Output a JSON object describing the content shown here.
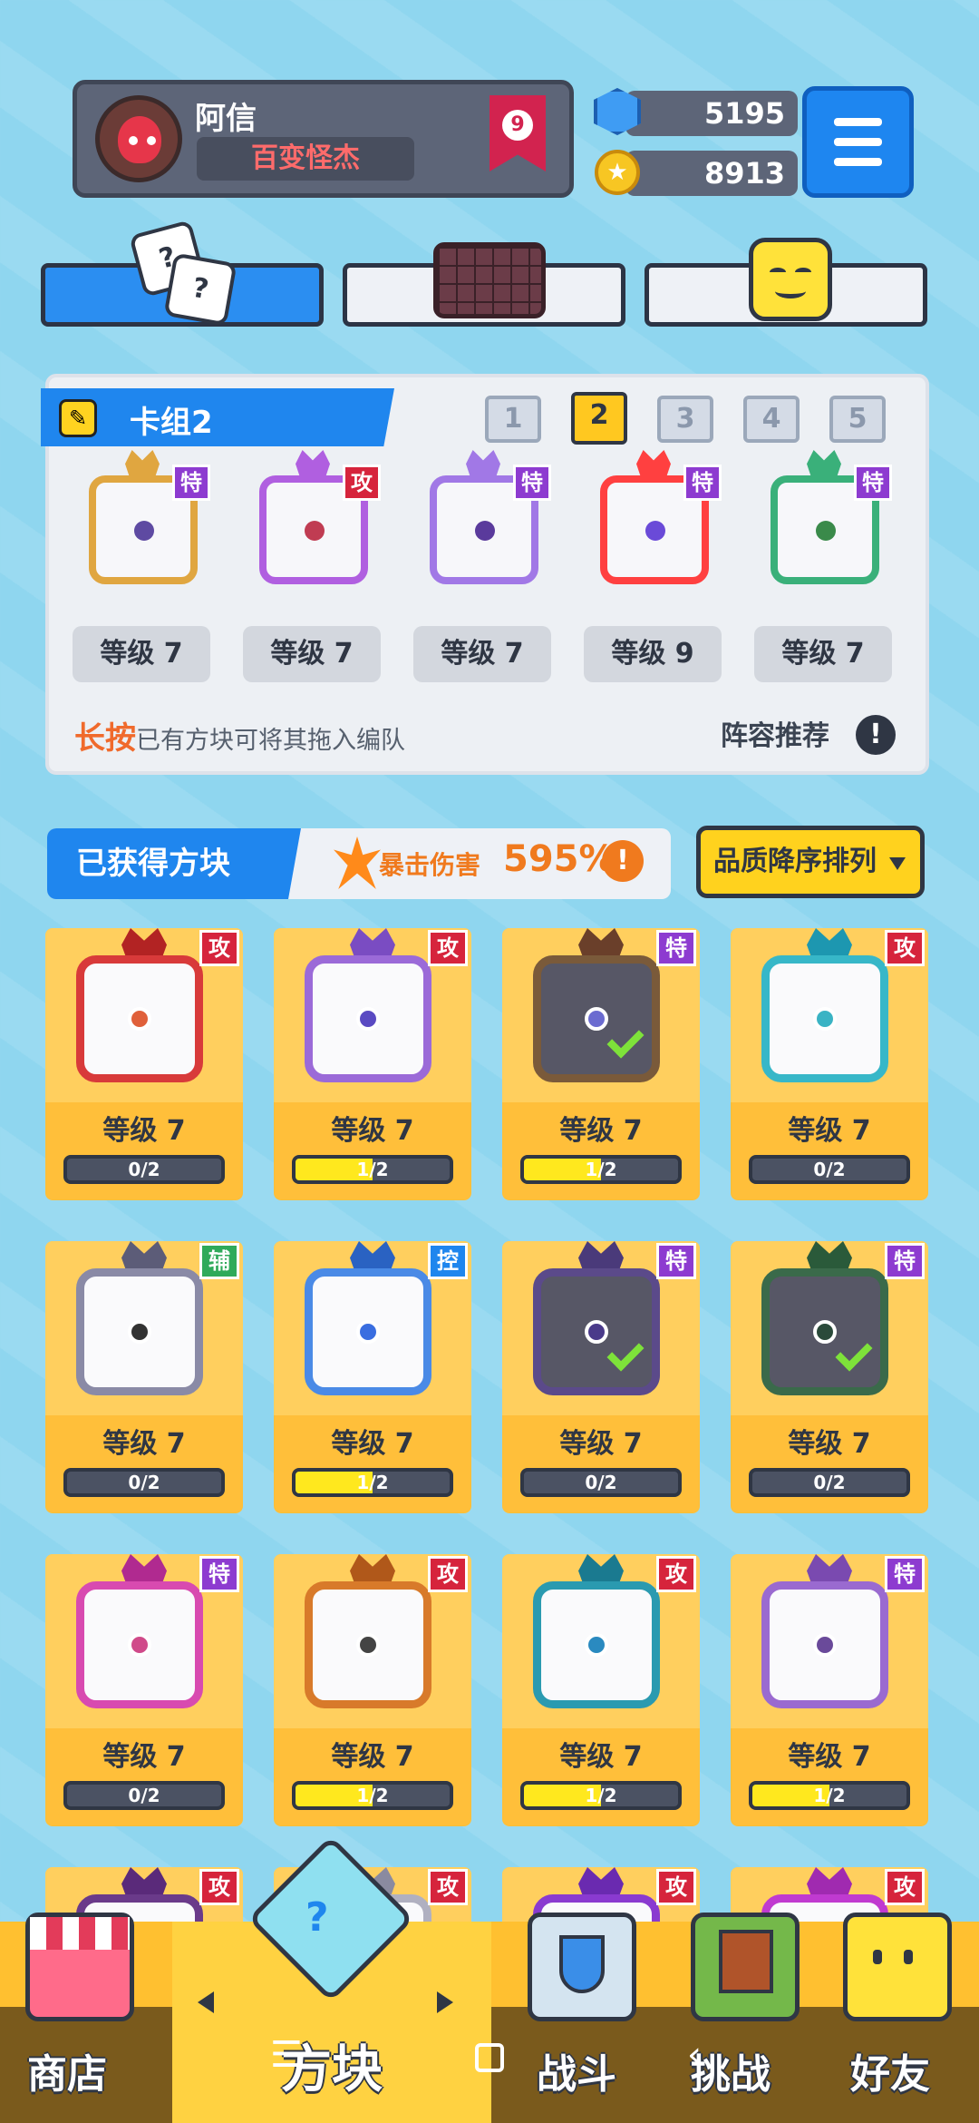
{
  "player": {
    "name": "阿信",
    "title": "百变怪杰",
    "rank": "9"
  },
  "currency": {
    "gems": "5195",
    "coins": "8913"
  },
  "deck": {
    "title": "卡组2",
    "numbers": [
      "1",
      "2",
      "3",
      "4",
      "5"
    ],
    "cards": [
      {
        "tag": "特",
        "tag_color": "#8d3bd0",
        "level": "等级 7",
        "ring": "#e0a640",
        "core": "#5e4aa2"
      },
      {
        "tag": "攻",
        "tag_color": "#d6243c",
        "level": "等级 7",
        "ring": "#b05fe0",
        "core": "#c03c52"
      },
      {
        "tag": "特",
        "tag_color": "#8d3bd0",
        "level": "等级 7",
        "ring": "#a178e6",
        "core": "#5a3a9c"
      },
      {
        "tag": "特",
        "tag_color": "#8d3bd0",
        "level": "等级 9",
        "ring": "#ff4040",
        "core": "#6a4ad8"
      },
      {
        "tag": "特",
        "tag_color": "#8d3bd0",
        "level": "等级 7",
        "ring": "#3ab07a",
        "core": "#3a8a4a"
      }
    ],
    "hint_bold": "长按",
    "hint_rest": "已有方块可将其拖入编队",
    "recommend": "阵容推荐"
  },
  "owned": {
    "title": "已获得方块",
    "crit_label": "暴击伤害",
    "crit_value": "595%",
    "sort": "品质降序排列"
  },
  "cards": [
    {
      "tag": "攻",
      "tag_color": "#d6243c",
      "level": "等级 7",
      "progress": "0/2",
      "fill": 0,
      "ring": "#d83a3a",
      "horn": "#b22323",
      "core": "#e0603a",
      "dark": false,
      "check": false
    },
    {
      "tag": "攻",
      "tag_color": "#d6243c",
      "level": "等级 7",
      "progress": "1/2",
      "fill": 0.5,
      "ring": "#9b6ad8",
      "horn": "#7a4cc2",
      "core": "#5a4ac2",
      "dark": false,
      "check": false
    },
    {
      "tag": "特",
      "tag_color": "#8d3bd0",
      "level": "等级 7",
      "progress": "1/2",
      "fill": 0.5,
      "ring": "#7a5a3a",
      "horn": "#6a3f2a",
      "core": "#6b6bd0",
      "dark": true,
      "check": true
    },
    {
      "tag": "攻",
      "tag_color": "#d6243c",
      "level": "等级 7",
      "progress": "0/2",
      "fill": 0,
      "ring": "#37b7c8",
      "horn": "#1d97b0",
      "core": "#3ab3c4",
      "dark": false,
      "check": false
    },
    {
      "tag": "辅",
      "tag_color": "#2faa5a",
      "level": "等级 7",
      "progress": "0/2",
      "fill": 0,
      "ring": "#8a8aa6",
      "horn": "#5c5c78",
      "core": "#333",
      "dark": false,
      "check": false
    },
    {
      "tag": "控",
      "tag_color": "#1f86ee",
      "level": "等级 7",
      "progress": "1/2",
      "fill": 0.5,
      "ring": "#4a8ae6",
      "horn": "#2a62c2",
      "core": "#3a6ee0",
      "dark": false,
      "check": false
    },
    {
      "tag": "特",
      "tag_color": "#8d3bd0",
      "level": "等级 7",
      "progress": "0/2",
      "fill": 0,
      "ring": "#5b4a8a",
      "horn": "#4a3a7a",
      "core": "#4a3a8a",
      "dark": true,
      "check": true
    },
    {
      "tag": "特",
      "tag_color": "#8d3bd0",
      "level": "等级 7",
      "progress": "0/2",
      "fill": 0,
      "ring": "#3a6a4a",
      "horn": "#2a5a3a",
      "core": "#2a4a3a",
      "dark": true,
      "check": true
    },
    {
      "tag": "特",
      "tag_color": "#8d3bd0",
      "level": "等级 7",
      "progress": "0/2",
      "fill": 0,
      "ring": "#d84ab0",
      "horn": "#b02a90",
      "core": "#d04a8a",
      "dark": false,
      "check": false
    },
    {
      "tag": "攻",
      "tag_color": "#d6243c",
      "level": "等级 7",
      "progress": "1/2",
      "fill": 0.5,
      "ring": "#d87a2a",
      "horn": "#b0581a",
      "core": "#444",
      "dark": false,
      "check": false
    },
    {
      "tag": "攻",
      "tag_color": "#d6243c",
      "level": "等级 7",
      "progress": "1/2",
      "fill": 0.5,
      "ring": "#2a9ab0",
      "horn": "#1a7a90",
      "core": "#2a8ac0",
      "dark": false,
      "check": false
    },
    {
      "tag": "特",
      "tag_color": "#8d3bd0",
      "level": "等级 7",
      "progress": "1/2",
      "fill": 0.5,
      "ring": "#9a6ad0",
      "horn": "#7a4ab0",
      "core": "#6a4a9a",
      "dark": false,
      "check": false
    },
    {
      "tag": "攻",
      "tag_color": "#d6243c",
      "level": "",
      "progress": "",
      "fill": 0,
      "ring": "#6a3a8a",
      "horn": "#5a2a7a",
      "core": "#555",
      "dark": false,
      "check": false
    },
    {
      "tag": "攻",
      "tag_color": "#d6243c",
      "level": "",
      "progress": "",
      "fill": 0,
      "ring": "#b0b0c0",
      "horn": "#8a8aa0",
      "core": "#555",
      "dark": false,
      "check": false
    },
    {
      "tag": "攻",
      "tag_color": "#d6243c",
      "level": "",
      "progress": "",
      "fill": 0,
      "ring": "#8a3ad0",
      "horn": "#6a2ab0",
      "core": "#555",
      "dark": false,
      "check": false
    },
    {
      "tag": "攻",
      "tag_color": "#d6243c",
      "level": "",
      "progress": "",
      "fill": 0,
      "ring": "#c03ad0",
      "horn": "#a02ab0",
      "core": "#555",
      "dark": false,
      "check": false
    }
  ],
  "nav": {
    "shop": "商店",
    "blocks": "方块",
    "battle": "战斗",
    "challenge": "挑战",
    "friends": "好友"
  },
  "icons": {
    "gem": "gem-icon",
    "coin": "coin-icon",
    "menu": "hamburger-menu-icon",
    "check": "checkmark-icon"
  }
}
